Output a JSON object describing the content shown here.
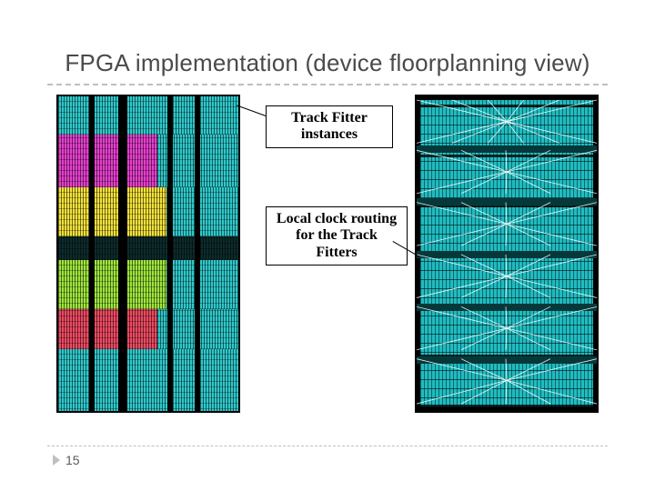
{
  "title": "FPGA implementation (device floorplanning view)",
  "labels": {
    "track_fitter_instances": "Track Fitter instances",
    "local_clock_routing": "Local clock routing for the Track Fitters"
  },
  "page_number": "15",
  "left_floorplan": {
    "description": "Coloured placement regions for Track Fitter instances",
    "region_colors": [
      "teal",
      "magenta",
      "yellow",
      "lime",
      "red",
      "dark-teal"
    ]
  },
  "right_floorplan": {
    "description": "Local clock routing fan-outs across teal FPGA fabric",
    "fanout_rows": 6
  }
}
